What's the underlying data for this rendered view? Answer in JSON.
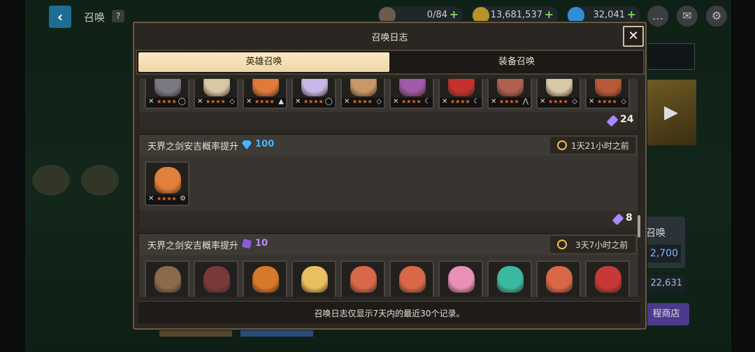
{
  "top": {
    "title": "召唤",
    "help": "?",
    "resources": [
      {
        "icon": "stamina-icon",
        "value": "0/84",
        "color": "#6b5d4a"
      },
      {
        "icon": "gold-coin-icon",
        "value": "13,681,537",
        "color": "#b8922a"
      },
      {
        "icon": "gem-icon",
        "value": "32,041",
        "color": "#2f8fd6"
      }
    ],
    "icons": [
      "chat-icon",
      "mail-icon",
      "settings-icon"
    ]
  },
  "background": {
    "right_label": "召唤",
    "right_value_1": "2,700",
    "right_value_2": "22,631",
    "right_button": "程商店"
  },
  "modal": {
    "title": "召唤日志",
    "close": "✕",
    "tabs": [
      {
        "label": "英雄召唤",
        "active": true
      },
      {
        "label": "装备召唤",
        "active": false
      }
    ],
    "entries": [
      {
        "title": "",
        "cost_value": "",
        "time": "",
        "crystal_count": "24",
        "heroes": [
          {
            "color": "#7a7a84",
            "element": "◯"
          },
          {
            "color": "#d8c8a8",
            "element": "◇"
          },
          {
            "color": "#e07a3a",
            "element": "▲"
          },
          {
            "color": "#c8b8e8",
            "element": "◯"
          },
          {
            "color": "#c89868",
            "element": "◇"
          },
          {
            "color": "#a05aa8",
            "element": "☾"
          },
          {
            "color": "#c83030",
            "element": "☾"
          },
          {
            "color": "#b06050",
            "element": "⋀"
          },
          {
            "color": "#d8c8a8",
            "element": "◇"
          },
          {
            "color": "#b85a3a",
            "element": "◇"
          }
        ]
      },
      {
        "title": "天界之剑安吉概率提升",
        "cost_icon": "gem-icon",
        "cost_value": "100",
        "cost_color": "#4ab4ff",
        "time": "1天21小时之前",
        "crystal_count": "8",
        "heroes": [
          {
            "color": "#e0803a",
            "element": "⚙"
          }
        ]
      },
      {
        "title": "天界之剑安吉概率提升",
        "cost_icon": "summon-ticket-icon",
        "cost_value": "10",
        "cost_color": "#b68cff",
        "time": "3天7小时之前",
        "crystal_count": "",
        "heroes": [
          {
            "color": "#8a6a4a",
            "element": ""
          },
          {
            "color": "#7a3a3a",
            "element": ""
          },
          {
            "color": "#d8782a",
            "element": ""
          },
          {
            "color": "#e8c060",
            "element": ""
          },
          {
            "color": "#d86848",
            "element": ""
          },
          {
            "color": "#d86848",
            "element": ""
          },
          {
            "color": "#e890b8",
            "element": ""
          },
          {
            "color": "#3ab8a0",
            "element": ""
          },
          {
            "color": "#d86848",
            "element": ""
          },
          {
            "color": "#c83838",
            "element": ""
          }
        ]
      }
    ],
    "footer_text": "召唤日志仅显示7天内的最近30个记录。"
  }
}
